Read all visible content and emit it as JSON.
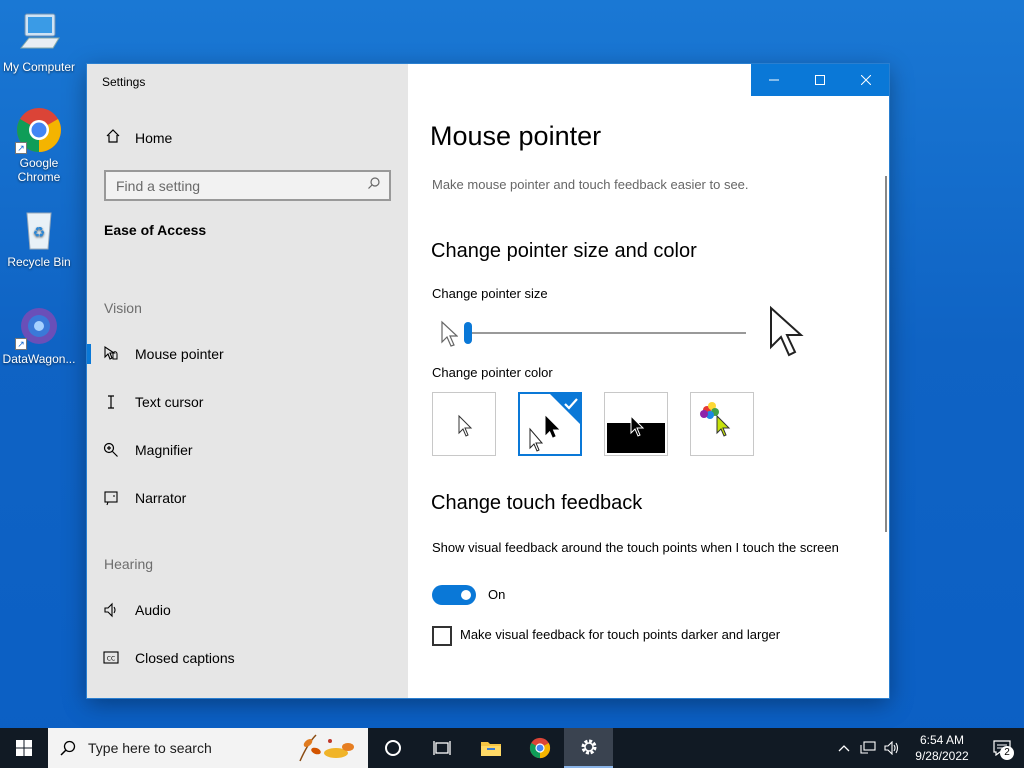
{
  "desktop": {
    "icons": [
      {
        "label": "My Computer",
        "icon": "computer-icon"
      },
      {
        "label": "Google Chrome",
        "icon": "chrome-icon"
      },
      {
        "label": "Recycle Bin",
        "icon": "recycle-bin-icon"
      },
      {
        "label": "DataWagon...",
        "icon": "datawagon-icon"
      }
    ]
  },
  "window": {
    "title": "Settings",
    "controls": {
      "minimize": "minimize-icon",
      "maximize": "maximize-icon",
      "close": "close-icon"
    }
  },
  "sidebar": {
    "home": "Home",
    "search_placeholder": "Find a setting",
    "section": "Ease of Access",
    "vision_header": "Vision",
    "vision_items": [
      {
        "label": "Mouse pointer",
        "icon": "mouse-pointer-icon",
        "selected": true
      },
      {
        "label": "Text cursor",
        "icon": "text-cursor-icon"
      },
      {
        "label": "Magnifier",
        "icon": "magnifier-icon"
      },
      {
        "label": "Narrator",
        "icon": "narrator-icon"
      }
    ],
    "hearing_header": "Hearing",
    "hearing_items": [
      {
        "label": "Audio",
        "icon": "audio-icon"
      },
      {
        "label": "Closed captions",
        "icon": "closed-captions-icon"
      }
    ]
  },
  "main": {
    "title": "Mouse pointer",
    "description": "Make mouse pointer and touch feedback easier to see.",
    "size_color_heading": "Change pointer size and color",
    "size_label": "Change pointer size",
    "size_value_fraction": 0.0,
    "color_label": "Change pointer color",
    "color_options": [
      {
        "name": "white",
        "selected": false
      },
      {
        "name": "black",
        "selected": true
      },
      {
        "name": "inverted",
        "selected": false
      },
      {
        "name": "custom",
        "selected": false
      }
    ],
    "touch_heading": "Change touch feedback",
    "touch_desc": "Show visual feedback around the touch points when I touch the screen",
    "toggle_state": "On",
    "checkbox_label": "Make visual feedback for touch points darker and larger",
    "checkbox_checked": false
  },
  "taskbar": {
    "search_placeholder": "Type here to search",
    "time": "6:54 AM",
    "date": "9/28/2022",
    "notification_count": "2",
    "accent": "#0a78d7"
  }
}
